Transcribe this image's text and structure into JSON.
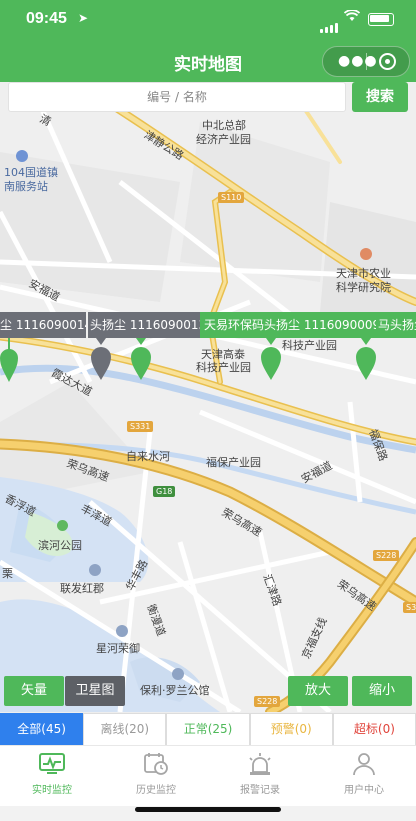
{
  "status_bar": {
    "time": "09:45",
    "location_glyph": "➤"
  },
  "navbar": {
    "title": "实时地图"
  },
  "search": {
    "placeholder": "编号 / 名称",
    "button": "搜索"
  },
  "map": {
    "labels": {
      "zhongbei_1": "中北总部",
      "zhongbei_2": "经济产业园",
      "jinjing_road": "津静公路",
      "guodao_1": "104国道镇",
      "guodao_2": "南服务站",
      "s110": "S110",
      "agri_1": "天津市农业",
      "agri_2": "科学研究院",
      "anfu_road": "安福道",
      "keji_partial": "科技产业园",
      "gaotai_1": "天津高泰",
      "gaotai_2": "科技产业园",
      "xiada_road": "霞达大道",
      "s331": "S331",
      "laiyuan_river": "自来水河",
      "fubao_park": "福保产业园",
      "anfu_road2": "安福道",
      "fubao_road": "福保路",
      "rongwu_hw": "荣乌高速",
      "g18": "G18",
      "xiangyu_road": "香浮道",
      "fengze_road": "丰泽道",
      "binhe_park": "滨河公园",
      "lianfa": "联发红郡",
      "huafeng_road": "华丰路",
      "rongwu_hw2": "荣乌高速",
      "s228": "S228",
      "rongwu_hw3": "荣乌高速",
      "huijin_road": "汇津路",
      "jinghai_road": "京福支线",
      "xinghe": "星河荣御",
      "baoli": "保利·罗兰公馆",
      "s228b": "S228",
      "s3": "S3",
      "li": "栗",
      "qing": "清",
      "hengyuan": "衡漫道"
    },
    "markers": [
      {
        "label": "尘 1116090014",
        "status": "offline"
      },
      {
        "label": "头扬尘 1116090013",
        "status": "offline"
      },
      {
        "label": "天易环保码头扬尘 1116090009",
        "status": "normal"
      },
      {
        "label": "马头扬尘 111",
        "status": "normal"
      }
    ]
  },
  "controls": {
    "vector": "矢量",
    "satellite": "卫星图",
    "zoom_in": "放大",
    "zoom_out": "缩小"
  },
  "filters": [
    {
      "label": "全部(45)",
      "active": true,
      "color": "#ffffff"
    },
    {
      "label": "离线(20)",
      "active": false,
      "color": "#9a9a9a"
    },
    {
      "label": "正常(25)",
      "active": false,
      "color": "#4fb85a"
    },
    {
      "label": "预警(0)",
      "active": false,
      "color": "#e9b640"
    },
    {
      "label": "超标(0)",
      "active": false,
      "color": "#e0443b"
    }
  ],
  "tabs": [
    {
      "label": "实时监控",
      "icon": "monitor-chart-icon",
      "active": true
    },
    {
      "label": "历史监控",
      "icon": "history-calendar-icon",
      "active": false
    },
    {
      "label": "报警记录",
      "icon": "alarm-light-icon",
      "active": false
    },
    {
      "label": "用户中心",
      "icon": "user-icon",
      "active": false
    }
  ],
  "colors": {
    "brand_green": "#4fb85a",
    "active_blue": "#2f80ed",
    "offline_grey": "#6c6f77",
    "road_yellow": "#f6d77a"
  }
}
